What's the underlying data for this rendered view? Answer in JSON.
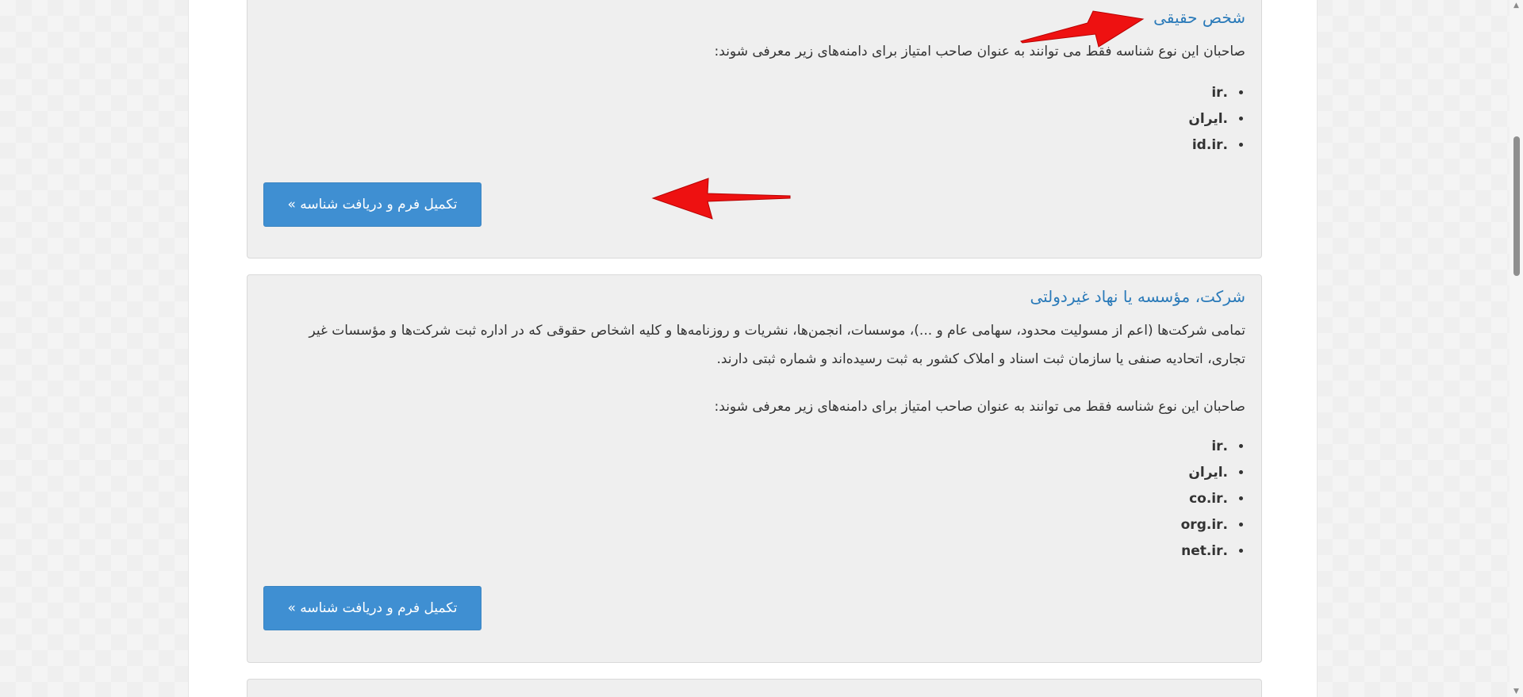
{
  "cards": [
    {
      "title": "شخص حقیقی",
      "intro": "صاحبان این نوع شناسه فقط می توانند به عنوان صاحب امتیاز برای دامنه‌های زیر معرفی شوند:",
      "domains": [
        ".ir",
        ".ایران",
        ".id.ir"
      ],
      "button_label": "تکمیل فرم و دریافت شناسه »"
    },
    {
      "title": "شرکت، مؤسسه یا نهاد غیردولتی",
      "description": "تمامی شرکت‌ها (اعم از مسولیت محدود، سهامی عام و ...)، موسسات، انجمن‌ها، نشریات و روزنامه‌ها و کلیه اشخاص حقوقی که در اداره ثبت شرکت‌ها و مؤسسات غیر تجاری، اتحادیه صنفی یا سازمان ثبت اسناد و املاک کشور به ثبت رسیده‌اند و شماره ثبتی دارند.",
      "intro": "صاحبان این نوع شناسه فقط می توانند به عنوان صاحب امتیاز برای دامنه‌های زیر معرفی شوند:",
      "domains": [
        ".ir",
        ".ایران",
        ".co.ir",
        ".org.ir",
        ".net.ir"
      ],
      "button_label": "تکمیل فرم و دریافت شناسه »"
    }
  ],
  "colors": {
    "title": "#2a7ab9",
    "button": "#3f8fd2",
    "card_bg": "#efefef",
    "annotation_arrow": "#ee1111"
  },
  "icons": {
    "scroll_up": "chevron-up-icon",
    "scroll_down": "chevron-down-icon"
  }
}
